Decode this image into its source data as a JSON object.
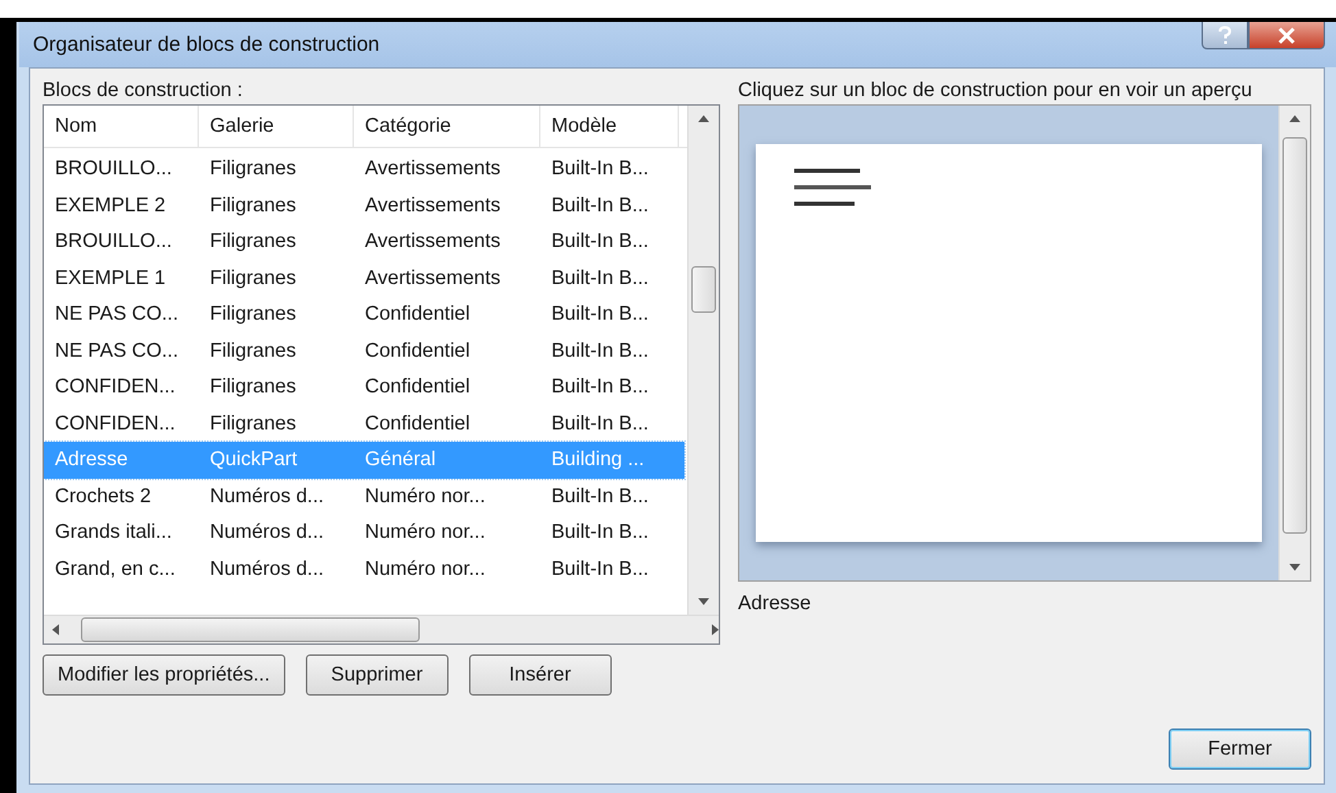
{
  "window": {
    "title": "Organisateur de blocs de construction"
  },
  "blocks": {
    "label": "Blocs de construction :",
    "columns": [
      "Nom",
      "Galerie",
      "Catégorie",
      "Modèle"
    ],
    "rows": [
      {
        "cells": [
          "BROUILLO...",
          "Filigranes",
          "Avertissements",
          "Built-In B..."
        ],
        "selected": false
      },
      {
        "cells": [
          "EXEMPLE 2",
          "Filigranes",
          "Avertissements",
          "Built-In B..."
        ],
        "selected": false
      },
      {
        "cells": [
          "BROUILLO...",
          "Filigranes",
          "Avertissements",
          "Built-In B..."
        ],
        "selected": false
      },
      {
        "cells": [
          "EXEMPLE 1",
          "Filigranes",
          "Avertissements",
          "Built-In B..."
        ],
        "selected": false
      },
      {
        "cells": [
          "NE PAS CO...",
          "Filigranes",
          "Confidentiel",
          "Built-In B..."
        ],
        "selected": false
      },
      {
        "cells": [
          "NE PAS CO...",
          "Filigranes",
          "Confidentiel",
          "Built-In B..."
        ],
        "selected": false
      },
      {
        "cells": [
          "CONFIDEN...",
          "Filigranes",
          "Confidentiel",
          "Built-In B..."
        ],
        "selected": false
      },
      {
        "cells": [
          "CONFIDEN...",
          "Filigranes",
          "Confidentiel",
          "Built-In B..."
        ],
        "selected": false
      },
      {
        "cells": [
          "Adresse",
          "QuickPart",
          "Général",
          "Building ..."
        ],
        "selected": true
      },
      {
        "cells": [
          "Crochets 2",
          "Numéros d...",
          "Numéro nor...",
          "Built-In B..."
        ],
        "selected": false
      },
      {
        "cells": [
          "Grands itali...",
          "Numéros d...",
          "Numéro nor...",
          "Built-In B..."
        ],
        "selected": false
      },
      {
        "cells": [
          "Grand, en c...",
          "Numéros d...",
          "Numéro nor...",
          "Built-In B..."
        ],
        "selected": false
      }
    ]
  },
  "buttons": [
    "Modifier les propriétés...",
    "Supprimer",
    "Insérer"
  ],
  "preview": {
    "label": "Cliquez sur un bloc de construction pour en voir un aperçu",
    "caption": "Adresse"
  },
  "close_button": "Fermer"
}
